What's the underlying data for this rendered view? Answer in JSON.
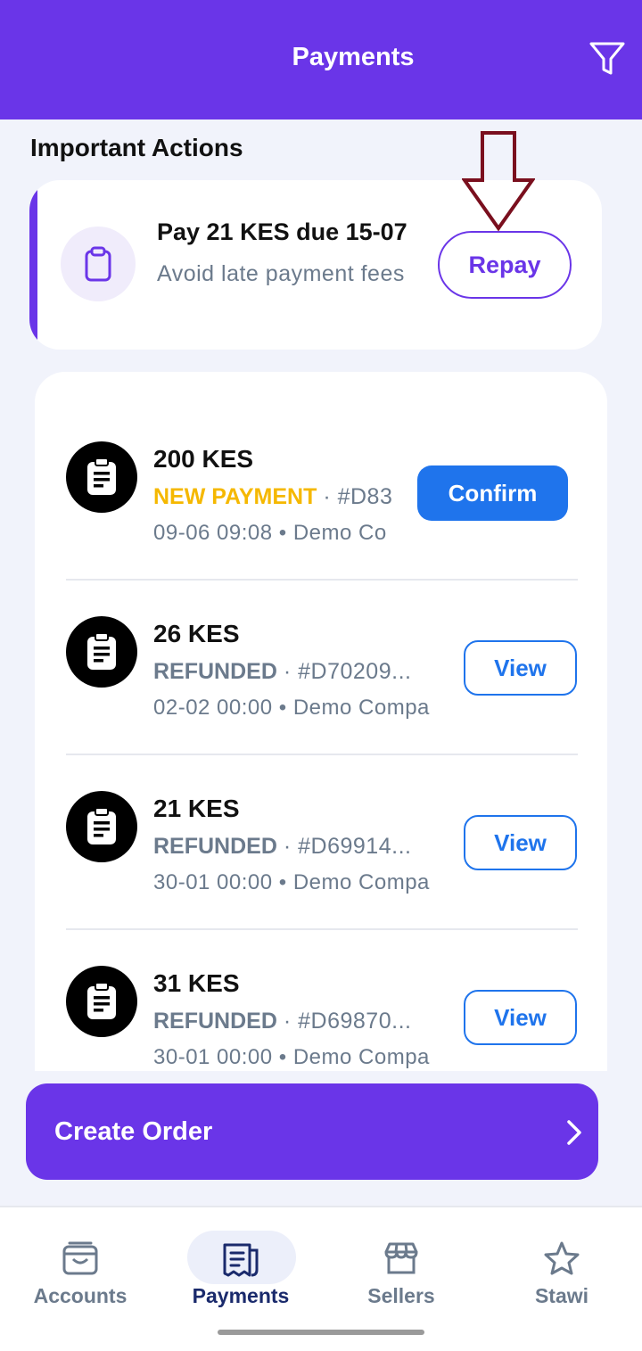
{
  "header": {
    "title": "Payments"
  },
  "important_actions": {
    "title": "Important Actions",
    "card": {
      "title": "Pay 21 KES due 15-07",
      "subtitle": "Avoid late payment fees",
      "button_label": "Repay"
    }
  },
  "payments": [
    {
      "amount": "200 KES",
      "status": "NEW PAYMENT",
      "ref": "#D83",
      "meta": "09-06 09:08 • Demo Co",
      "action": "Confirm"
    },
    {
      "amount": "26 KES",
      "status": "REFUNDED",
      "ref": "#D70209...",
      "meta": "02-02 00:00 • Demo Compa",
      "action": "View"
    },
    {
      "amount": "21 KES",
      "status": "REFUNDED",
      "ref": "#D69914...",
      "meta": "30-01 00:00 • Demo Compa",
      "action": "View"
    },
    {
      "amount": "31 KES",
      "status": "REFUNDED",
      "ref": "#D69870...",
      "meta": "30-01 00:00 • Demo Compa",
      "action": "View"
    }
  ],
  "create_order": {
    "label": "Create Order"
  },
  "nav": {
    "items": [
      {
        "label": "Accounts",
        "icon": "wallet-icon"
      },
      {
        "label": "Payments",
        "icon": "receipt-icon",
        "active": true
      },
      {
        "label": "Sellers",
        "icon": "store-icon"
      },
      {
        "label": "Stawi",
        "icon": "star-icon"
      }
    ]
  },
  "colors": {
    "brand": "#6a35e8",
    "primary_button": "#1f74ec",
    "new_status": "#f5b800",
    "muted_text": "#6b7a8c",
    "annotation_arrow": "#7a0f1e"
  }
}
